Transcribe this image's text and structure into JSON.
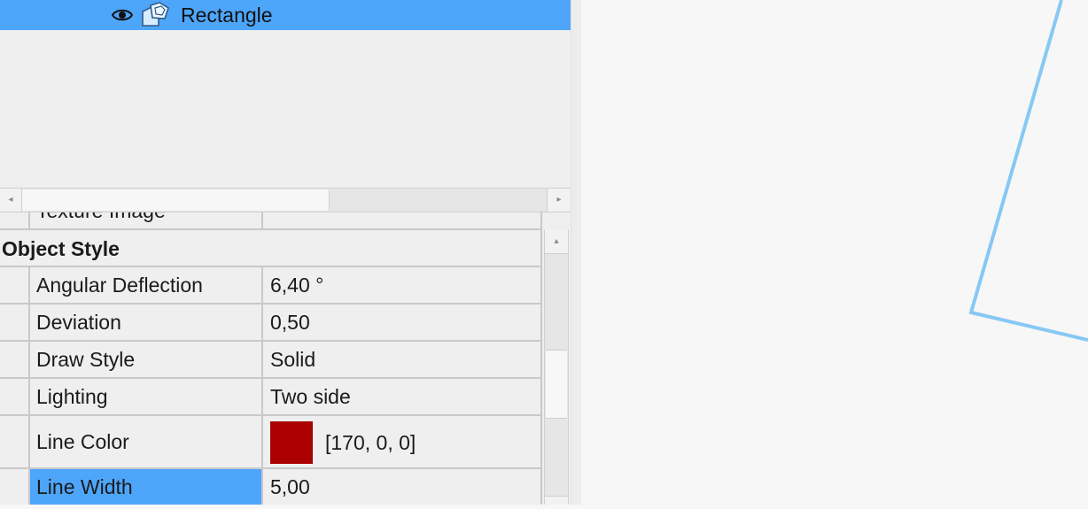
{
  "tree": {
    "selected_item": {
      "label": "Rectangle",
      "visibility_icon": "eye-icon",
      "type_icon": "shape-icon"
    }
  },
  "properties": {
    "partial_top_row": {
      "name": "Texture Image",
      "value": ""
    },
    "group": {
      "title": "Object Style"
    },
    "rows": [
      {
        "name": "Angular Deflection",
        "value": "6,40 °"
      },
      {
        "name": "Deviation",
        "value": "0,50"
      },
      {
        "name": "Draw Style",
        "value": "Solid"
      },
      {
        "name": "Lighting",
        "value": "Two side"
      },
      {
        "name": "Line Color",
        "value": "[170, 0, 0]",
        "swatch_color": "#aa0000"
      },
      {
        "name": "Line Width",
        "value": "5,00",
        "selected": true
      }
    ]
  },
  "colors": {
    "selection": "#4ea6fb",
    "viewport_line": "#87c8f4",
    "line_color": "#aa0000"
  }
}
